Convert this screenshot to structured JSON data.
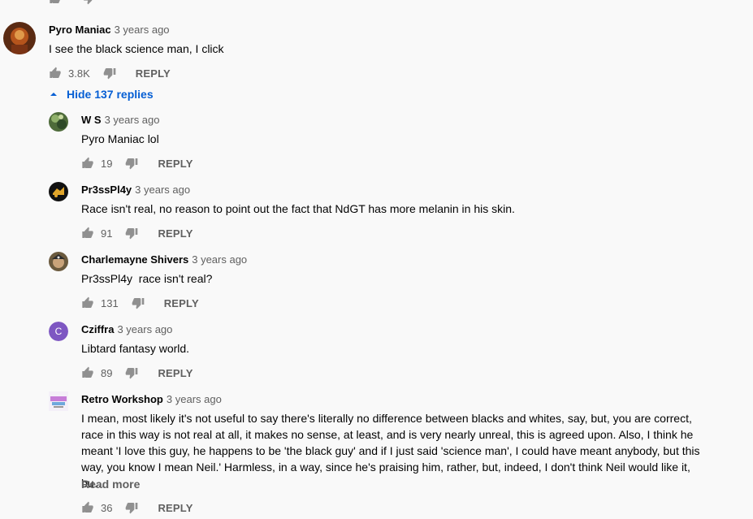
{
  "top_comment": {
    "author": "Pyro Maniac",
    "time": "3 years ago",
    "text": "I see the black science man, I click",
    "likes": "3.8K",
    "reply_label": "REPLY"
  },
  "hide_replies_label": "Hide 137 replies",
  "replies": [
    {
      "author": "W S",
      "time": "3 years ago",
      "text": "Pyro Maniac lol",
      "likes": "19",
      "reply_label": "REPLY"
    },
    {
      "author": "Pr3ssPl4y",
      "time": "3 years ago",
      "text": "Race isn't real, no reason to point out the fact that NdGT has more melanin in his skin.",
      "likes": "91",
      "reply_label": "REPLY"
    },
    {
      "author": "Charlemayne Shivers",
      "time": "3 years ago",
      "text": "Pr3ssPl4y  race isn't real?",
      "likes": "131",
      "reply_label": "REPLY"
    },
    {
      "author": "Cziffra",
      "avatar_letter": "C",
      "time": "3 years ago",
      "text": "Libtard fantasy world.",
      "likes": "89",
      "reply_label": "REPLY"
    },
    {
      "author": "Retro Workshop",
      "time": "3 years ago",
      "text": "I mean, most likely it's not useful to say there's literally no difference between blacks and whites, say, but, you are correct, race in this way is not real at all, it makes no sense, at least, and is very nearly unreal, this is agreed upon. Also, I think he meant 'I love this guy, he happens to be 'the black guy' and if I just said 'science man', I could have meant anybody, but this way, you know I mean Neil.' Harmless, in a way, since he's praising him, rather, but, indeed, I don't think Neil would like it, bu…",
      "read_more": "Read more",
      "likes": "36",
      "reply_label": "REPLY"
    }
  ],
  "colors": {
    "link": "#065fd4",
    "secondary": "#606060",
    "background": "#f9f9f9",
    "avatar_purple": "#7e57c2"
  }
}
